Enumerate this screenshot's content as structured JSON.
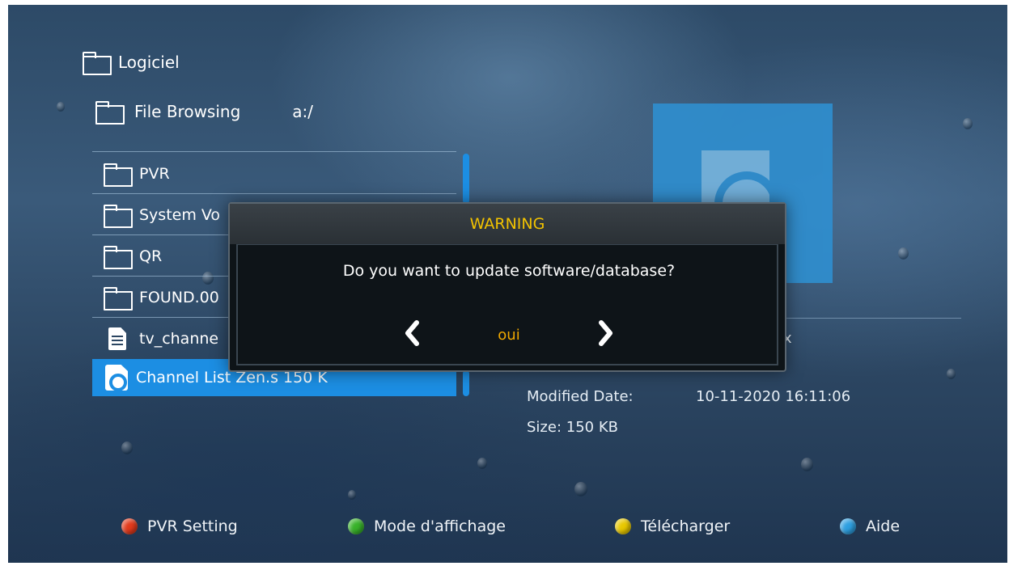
{
  "breadcrumb": {
    "root_label": "Logiciel",
    "browse_label": "File Browsing",
    "path": "a:/"
  },
  "file_list": [
    {
      "label": "PVR",
      "icon": "folder-icon"
    },
    {
      "label": "System Vo",
      "icon": "folder-icon"
    },
    {
      "label": "QR",
      "icon": "folder-icon"
    },
    {
      "label": "FOUND.00",
      "icon": "folder-icon"
    },
    {
      "label": "tv_channe",
      "icon": "document-icon"
    },
    {
      "label": "Channel List Zen.s   150 K",
      "icon": "disc-file-icon",
      "selected": true
    }
  ],
  "file_info": {
    "type_value": "x",
    "modified_label": "Modified Date:",
    "modified_value": "10-11-2020 16:11:06",
    "size_text": "Size: 150 KB"
  },
  "dialog": {
    "title": "WARNING",
    "message": "Do you want to update software/database?",
    "option": "oui"
  },
  "footer": [
    {
      "label": "PVR Setting",
      "color": "#e23a1c"
    },
    {
      "label": "Mode d'affichage",
      "color": "#38b22a"
    },
    {
      "label": "Télécharger",
      "color": "#e8c800"
    },
    {
      "label": "Aide",
      "color": "#2e9fe0"
    }
  ],
  "colors": {
    "accent_blue": "#1c8ee3",
    "warning_title": "#f3c300",
    "option_text": "#f0a800"
  }
}
